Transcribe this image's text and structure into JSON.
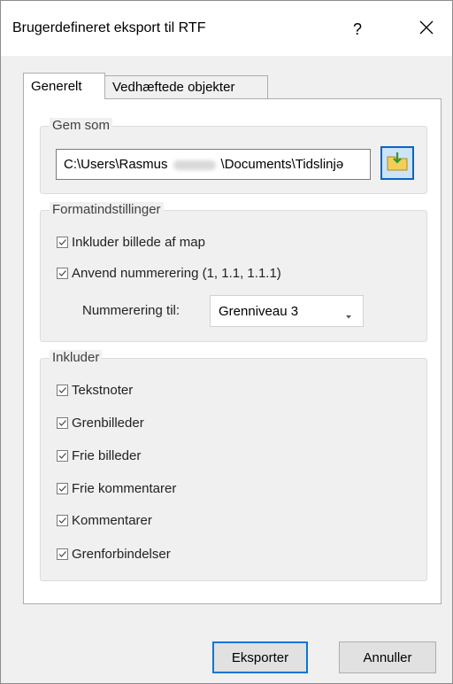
{
  "window": {
    "title": "Brugerdefineret eksport til RTF",
    "help_label": "?"
  },
  "tabs": [
    {
      "label": "Generelt",
      "active": true
    },
    {
      "label": "Vedhæftede objekter",
      "active": false
    }
  ],
  "save_as": {
    "legend": "Gem som",
    "path_prefix": "C:\\Users\\Rasmus",
    "path_suffix": "\\Documents\\Tidslinjə",
    "browse_icon": "folder-save-icon"
  },
  "format": {
    "legend": "Formatindstillinger",
    "options": [
      {
        "label": "Inkluder billede af map",
        "checked": true
      },
      {
        "label": "Anvend nummerering (1, 1.1, 1.1.1)",
        "checked": true
      }
    ],
    "numbering_label": "Nummerering til:",
    "numbering_value": "Grenniveau 3"
  },
  "include": {
    "legend": "Inkluder",
    "options": [
      {
        "label": "Tekstnoter",
        "checked": true
      },
      {
        "label": "Grenbilleder",
        "checked": true
      },
      {
        "label": "Frie billeder",
        "checked": true
      },
      {
        "label": "Frie kommentarer",
        "checked": true
      },
      {
        "label": "Kommentarer",
        "checked": true
      },
      {
        "label": "Grenforbindelser",
        "checked": true
      }
    ]
  },
  "buttons": {
    "export": "Eksporter",
    "cancel": "Annuller"
  },
  "colors": {
    "accent": "#0078d7",
    "checkmark": "#444444"
  }
}
